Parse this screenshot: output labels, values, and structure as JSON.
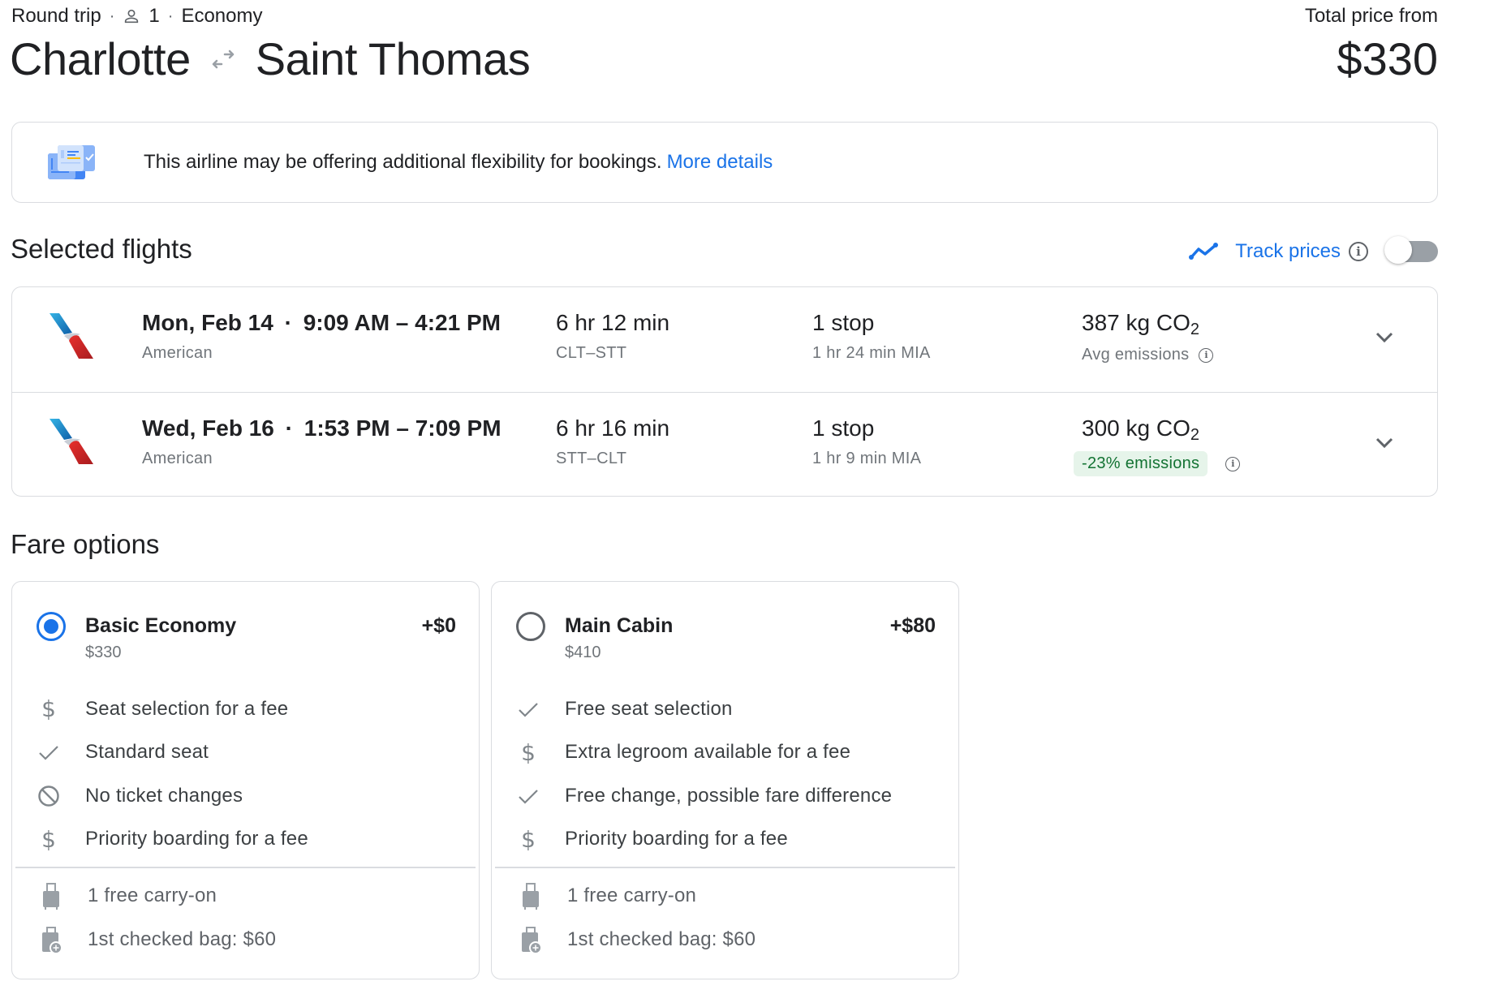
{
  "header": {
    "trip_type": "Round trip",
    "passengers": "1",
    "cabin": "Economy",
    "origin": "Charlotte",
    "destination": "Saint Thomas",
    "total_label": "Total price from",
    "total_price": "$330"
  },
  "banner": {
    "text": "This airline may be offering additional flexibility for bookings.",
    "link": "More details"
  },
  "selected_flights": {
    "title": "Selected flights",
    "track_prices_label": "Track prices",
    "track_prices_enabled": false,
    "flights": [
      {
        "date": "Mon, Feb 14",
        "times": "9:09 AM – 4:21 PM",
        "airline": "American",
        "duration": "6 hr 12 min",
        "route": "CLT–STT",
        "stops": "1 stop",
        "layover": "1 hr 24 min MIA",
        "emissions_value": "387 kg CO",
        "emissions_sub": "2",
        "emissions_note": "Avg emissions"
      },
      {
        "date": "Wed, Feb 16",
        "times": "1:53 PM – 7:09 PM",
        "airline": "American",
        "duration": "6 hr 16 min",
        "route": "STT–CLT",
        "stops": "1 stop",
        "layover": "1 hr 9 min MIA",
        "emissions_value": "300 kg CO",
        "emissions_sub": "2",
        "emissions_badge": "-23% emissions"
      }
    ]
  },
  "fare_options": {
    "title": "Fare options",
    "fares": [
      {
        "name": "Basic Economy",
        "price": "$330",
        "diff": "+$0",
        "selected": true,
        "features": [
          {
            "icon": "dollar-icon",
            "text": "Seat selection for a fee"
          },
          {
            "icon": "check-icon",
            "text": "Standard seat"
          },
          {
            "icon": "prohibited-icon",
            "text": "No ticket changes"
          },
          {
            "icon": "dollar-icon",
            "text": "Priority boarding for a fee"
          }
        ],
        "bags": [
          {
            "icon": "carry-on-bag-icon",
            "text": "1 free carry-on"
          },
          {
            "icon": "checked-bag-icon",
            "text": "1st checked bag: $60"
          }
        ]
      },
      {
        "name": "Main Cabin",
        "price": "$410",
        "diff": "+$80",
        "selected": false,
        "features": [
          {
            "icon": "check-icon",
            "text": "Free seat selection"
          },
          {
            "icon": "dollar-icon",
            "text": "Extra legroom available for a fee"
          },
          {
            "icon": "check-icon",
            "text": "Free change, possible fare difference"
          },
          {
            "icon": "dollar-icon",
            "text": "Priority boarding for a fee"
          }
        ],
        "bags": [
          {
            "icon": "carry-on-bag-icon",
            "text": "1 free carry-on"
          },
          {
            "icon": "checked-bag-icon",
            "text": "1st checked bag: $60"
          }
        ]
      }
    ]
  },
  "colors": {
    "accent": "#1a73e8",
    "text": "#202124",
    "muted": "#70757a",
    "border": "#dadce0",
    "emissions_badge_bg": "#e6f4ea",
    "emissions_badge_text": "#137333"
  }
}
